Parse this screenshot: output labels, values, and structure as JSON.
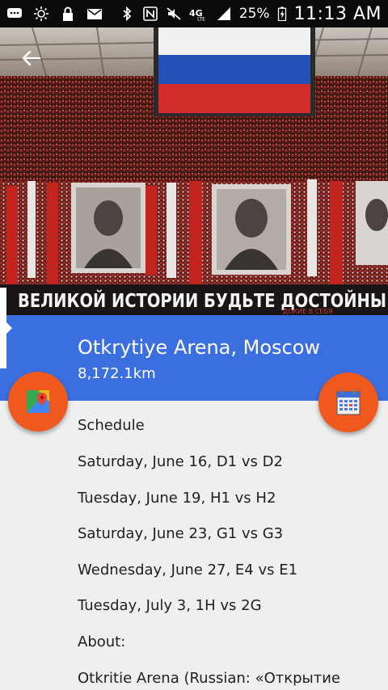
{
  "status_bar": {
    "icons": [
      "chat-icon",
      "brightness-icon",
      "lock-icon",
      "mail-icon",
      "bluetooth-icon",
      "nfc-icon",
      "mute-icon",
      "4g-lte-icon",
      "signal-icon",
      "battery-icon"
    ],
    "network": "4G",
    "battery": "25%",
    "time": "11:13 AM"
  },
  "hero": {
    "banner_text": "ВЕЛИКОЙ ИСТОРИИ БУДЬТЕ ДОСТОЙНЫ",
    "small_text": "ДОКИЕ В СЕБЯ"
  },
  "venue": {
    "title": "Otkrytiye Arena, Moscow",
    "distance": "8,172.1km"
  },
  "schedule": {
    "heading": "Schedule",
    "matches": [
      "Saturday, June 16, D1 vs D2",
      "Tuesday, June 19, H1 vs H2",
      "Saturday, June 23, G1 vs G3",
      "Wednesday, June 27, E4 vs E1",
      "Tuesday, July 3, 1H vs 2G"
    ]
  },
  "about": {
    "heading": "About:",
    "text": "Otkritie Arena (Russian: «Открытие"
  },
  "colors": {
    "band": "#3b6fe0",
    "fab": "#f0591d",
    "status_bar": "#0b0b0b",
    "background": "#efefef"
  }
}
